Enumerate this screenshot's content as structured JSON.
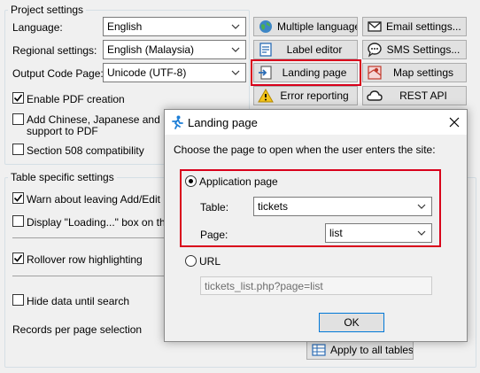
{
  "project_settings": {
    "title": "Project settings",
    "language": {
      "label": "Language:",
      "value": "English"
    },
    "regional": {
      "label": "Regional settings:",
      "value": "English (Malaysia)"
    },
    "codepage": {
      "label": "Output Code Page:",
      "value": "Unicode (UTF-8)"
    },
    "enable_pdf": {
      "label": "Enable PDF creation",
      "checked": true
    },
    "cjk_pdf": {
      "label_line1": "Add Chinese, Japanese and Kor",
      "label_line2": "support to PDF",
      "checked": false
    },
    "section508": {
      "label": "Section 508 compatibility",
      "checked": false
    }
  },
  "buttons": {
    "multiple_languages": {
      "label": "Multiple languages",
      "icon": "globe-icon"
    },
    "email_settings": {
      "label": "Email settings...",
      "icon": "envelope-icon"
    },
    "label_editor": {
      "label": "Label editor",
      "icon": "label-editor-icon"
    },
    "sms_settings": {
      "label": "SMS Settings...",
      "icon": "chat-bubble-icon"
    },
    "landing_page": {
      "label": "Landing page",
      "icon": "landing-page-icon"
    },
    "map_settings": {
      "label": "Map settings",
      "icon": "map-icon"
    },
    "error_reporting": {
      "label": "Error reporting",
      "icon": "warning-icon"
    },
    "rest_api": {
      "label": "REST API",
      "icon": "cloud-icon"
    }
  },
  "table_settings": {
    "title": "Table specific settings",
    "warn_leaving": {
      "label": "Warn about leaving Add/Edit pa",
      "checked": true
    },
    "display_loading": {
      "label": "Display \"Loading...\" box on the l",
      "checked": false
    },
    "rollover": {
      "label": "Rollover row highlighting",
      "checked": true
    },
    "hide_data": {
      "label": "Hide data until search",
      "checked": false
    },
    "records_per_page": {
      "label": "Records per page selection"
    },
    "apply_all": {
      "label": "Apply to all tables",
      "icon": "apply-tables-icon"
    }
  },
  "dialog": {
    "title": "Landing page",
    "icon": "runner-icon",
    "prompt": "Choose the page to open when the user enters the site:",
    "application_page": {
      "label": "Application page",
      "selected": true
    },
    "table": {
      "label": "Table:",
      "value": "tickets"
    },
    "page": {
      "label": "Page:",
      "value": "list"
    },
    "url": {
      "label": "URL",
      "selected": false,
      "value": "tickets_list.php?page=list"
    },
    "ok_label": "OK",
    "close_icon": "close-icon"
  },
  "colors": {
    "highlight": "#d9001b",
    "focus_border": "#0078d7"
  }
}
